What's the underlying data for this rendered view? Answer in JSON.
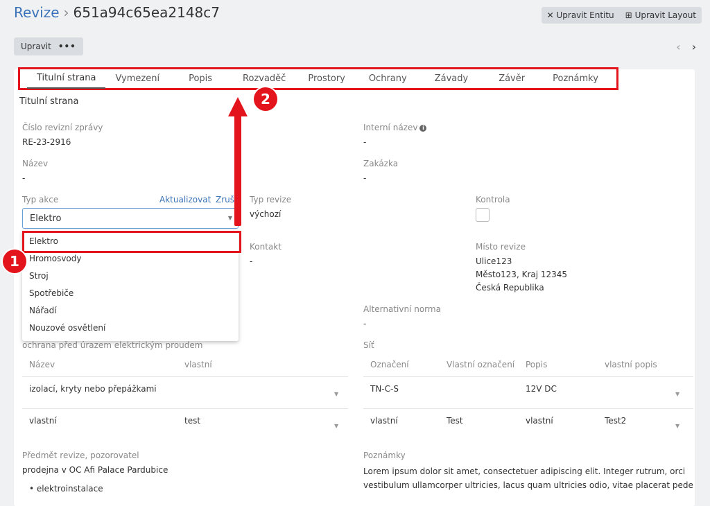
{
  "breadcrumb": {
    "root": "Revize",
    "separator": "›",
    "id": "651a94c65ea2148c7"
  },
  "toolbar": {
    "edit_entity": "Upravit Entitu",
    "edit_layout": "Upravit Layout",
    "edit": "Upravit",
    "more": "•••",
    "prev": "‹",
    "next": "›"
  },
  "tabs": [
    "Titulní strana",
    "Vymezení",
    "Popis",
    "Rozvaděč",
    "Prostory",
    "Ochrany",
    "Závady",
    "Závěr",
    "Poznámky"
  ],
  "section_title": "Titulní strana",
  "fields": {
    "report_no_label": "Číslo revizní zprávy",
    "report_no": "RE-23-2916",
    "internal_name_label": "Interní název",
    "internal_name": "-",
    "name_label": "Název",
    "name": "-",
    "order_label": "Zakázka",
    "order": "-",
    "action_type_label": "Typ akce",
    "action_update": "Aktualizovat",
    "action_cancel": "Zruš",
    "action_type_value": "Elektro",
    "revision_type_label": "Typ revize",
    "revision_type": "výchozí",
    "control_label": "Kontrola",
    "contact_label": "Kontakt",
    "contact": "-",
    "place_label": "Místo revize",
    "place_line1": "Ulice123",
    "place_line2": "Město123, Kraj 12345",
    "place_line3": "Česká Republika",
    "alt_norm_label": "Alternativní norma",
    "alt_norm": "-",
    "protection_label": "ochrana před úrazem elektrickým proudem",
    "network_label": "Síť",
    "subject_label": "Předmět revize, pozorovatel",
    "subject": "prodejna v OC Afi Palace Pardubice",
    "subject_bullet": "elektroinstalace",
    "notes_label": "Poznámky",
    "notes": "Lorem ipsum dolor sit amet, consectetuer adipiscing elit. Integer rutrum, orci vestibulum ullamcorper ultricies, lacus quam ultricies odio, vitae placerat pede sem sit amet enim. Phasellus rhoncus"
  },
  "dropdown_options": [
    "Elektro",
    "Hromosvody",
    "Stroj",
    "Spotřebiče",
    "Nářadí",
    "Nouzové osvětlení"
  ],
  "protection_table": {
    "headers": [
      "Název",
      "vlastní"
    ],
    "rows": [
      [
        "izolací, kryty nebo přepážkami",
        ""
      ],
      [
        "vlastní",
        "test"
      ]
    ]
  },
  "network_table": {
    "headers": [
      "Označení",
      "Vlastní označení",
      "Popis",
      "vlastní popis"
    ],
    "rows": [
      [
        "TN-C-S",
        "",
        "12V DC",
        ""
      ],
      [
        "vlastní",
        "Test",
        "vlastní",
        "Test2"
      ]
    ]
  },
  "annotations": {
    "badge1": "1",
    "badge2": "2"
  },
  "colors": {
    "accent": "#3b73b9",
    "highlight": "#e3141b"
  }
}
